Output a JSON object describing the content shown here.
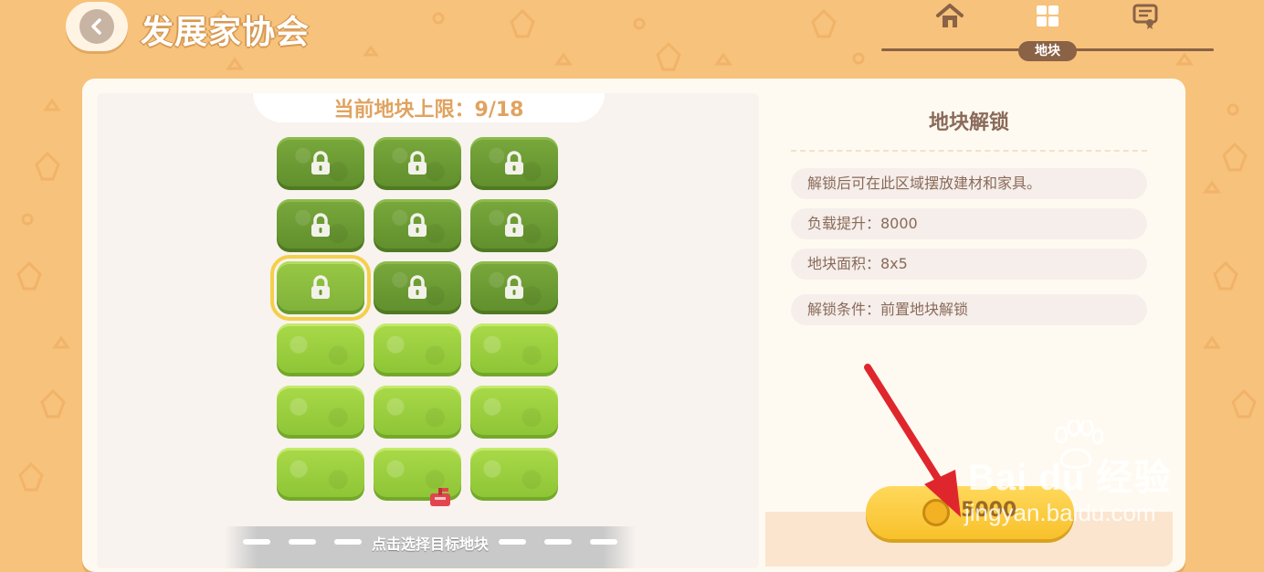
{
  "header": {
    "title": "发展家协会",
    "nav": {
      "items": [
        {
          "icon": "house-icon"
        },
        {
          "icon": "plot-grid-icon",
          "active_label": "地块"
        },
        {
          "icon": "certificate-icon"
        }
      ]
    }
  },
  "plots": {
    "capacity_label": "当前地块上限：9/18",
    "rows": [
      [
        "locked",
        "locked",
        "locked"
      ],
      [
        "locked",
        "locked",
        "locked"
      ],
      [
        "selected-locked",
        "locked",
        "locked"
      ],
      [
        "open",
        "open",
        "open"
      ],
      [
        "open",
        "open",
        "open"
      ],
      [
        "open",
        "open",
        "open"
      ]
    ],
    "hint": "点击选择目标地块"
  },
  "detail": {
    "title": "地块解锁",
    "description": "解锁后可在此区域摆放建材和家具。",
    "load_increase": "负载提升：8000",
    "area": "地块面积：8x5",
    "condition": "解锁条件：前置地块解锁",
    "unlock_button": {
      "price": "5000",
      "icon": "coin-icon"
    }
  },
  "watermark": {
    "brand": "Bai du 经验",
    "url": "jingyan.baidu.com"
  },
  "colors": {
    "background": "#f7c27b",
    "nav_brown": "#8a6246",
    "locked_tile": "#6b9a32",
    "open_tile": "#9fd043",
    "button_yellow": "#f8c12b",
    "annotation_arrow": "#e0262d"
  }
}
